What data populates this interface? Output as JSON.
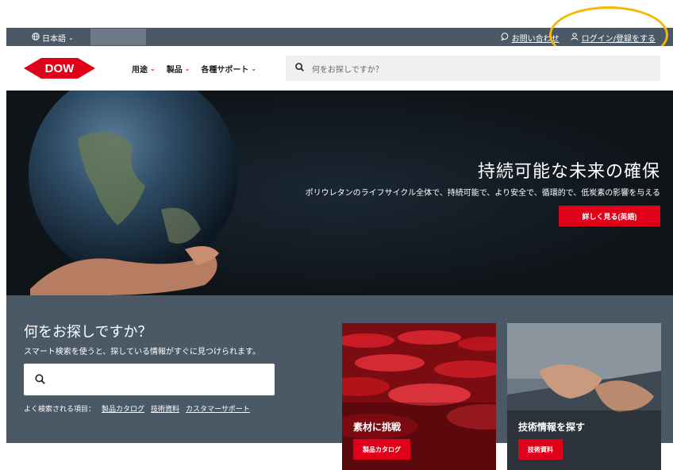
{
  "topbar": {
    "language": "日本語",
    "contact": "お問い合わせ",
    "login": "ログイン/登録をする"
  },
  "nav": {
    "logo_text": "DOW",
    "menu": [
      {
        "label": "用途"
      },
      {
        "label": "製品"
      },
      {
        "label": "各種サポート"
      }
    ],
    "search_placeholder": "何をお探しですか？"
  },
  "hero": {
    "title": "持続可能な未来の確保",
    "subtitle": "ポリウレタンのライフサイクル全体で、持続可能で、より安全で、循環的で、低炭素の影響を与える",
    "button": "詳しく見る(英語)"
  },
  "finder": {
    "title": "何をお探しですか？",
    "subtitle": "スマート検索を使うと、探している情報がすぐに見つけられます。",
    "popular_label": "よく検索される項目：",
    "popular_links": [
      "製品カタログ",
      "技術資料",
      "カスタマーサポート"
    ]
  },
  "cards": [
    {
      "title": "素材に挑戦",
      "button": "製品カタログ"
    },
    {
      "title": "技術情報を探す",
      "button": "技術資料"
    }
  ],
  "colors": {
    "brand_red": "#e1001a",
    "bar_slate": "#4b5866",
    "highlight": "#f5b800"
  }
}
